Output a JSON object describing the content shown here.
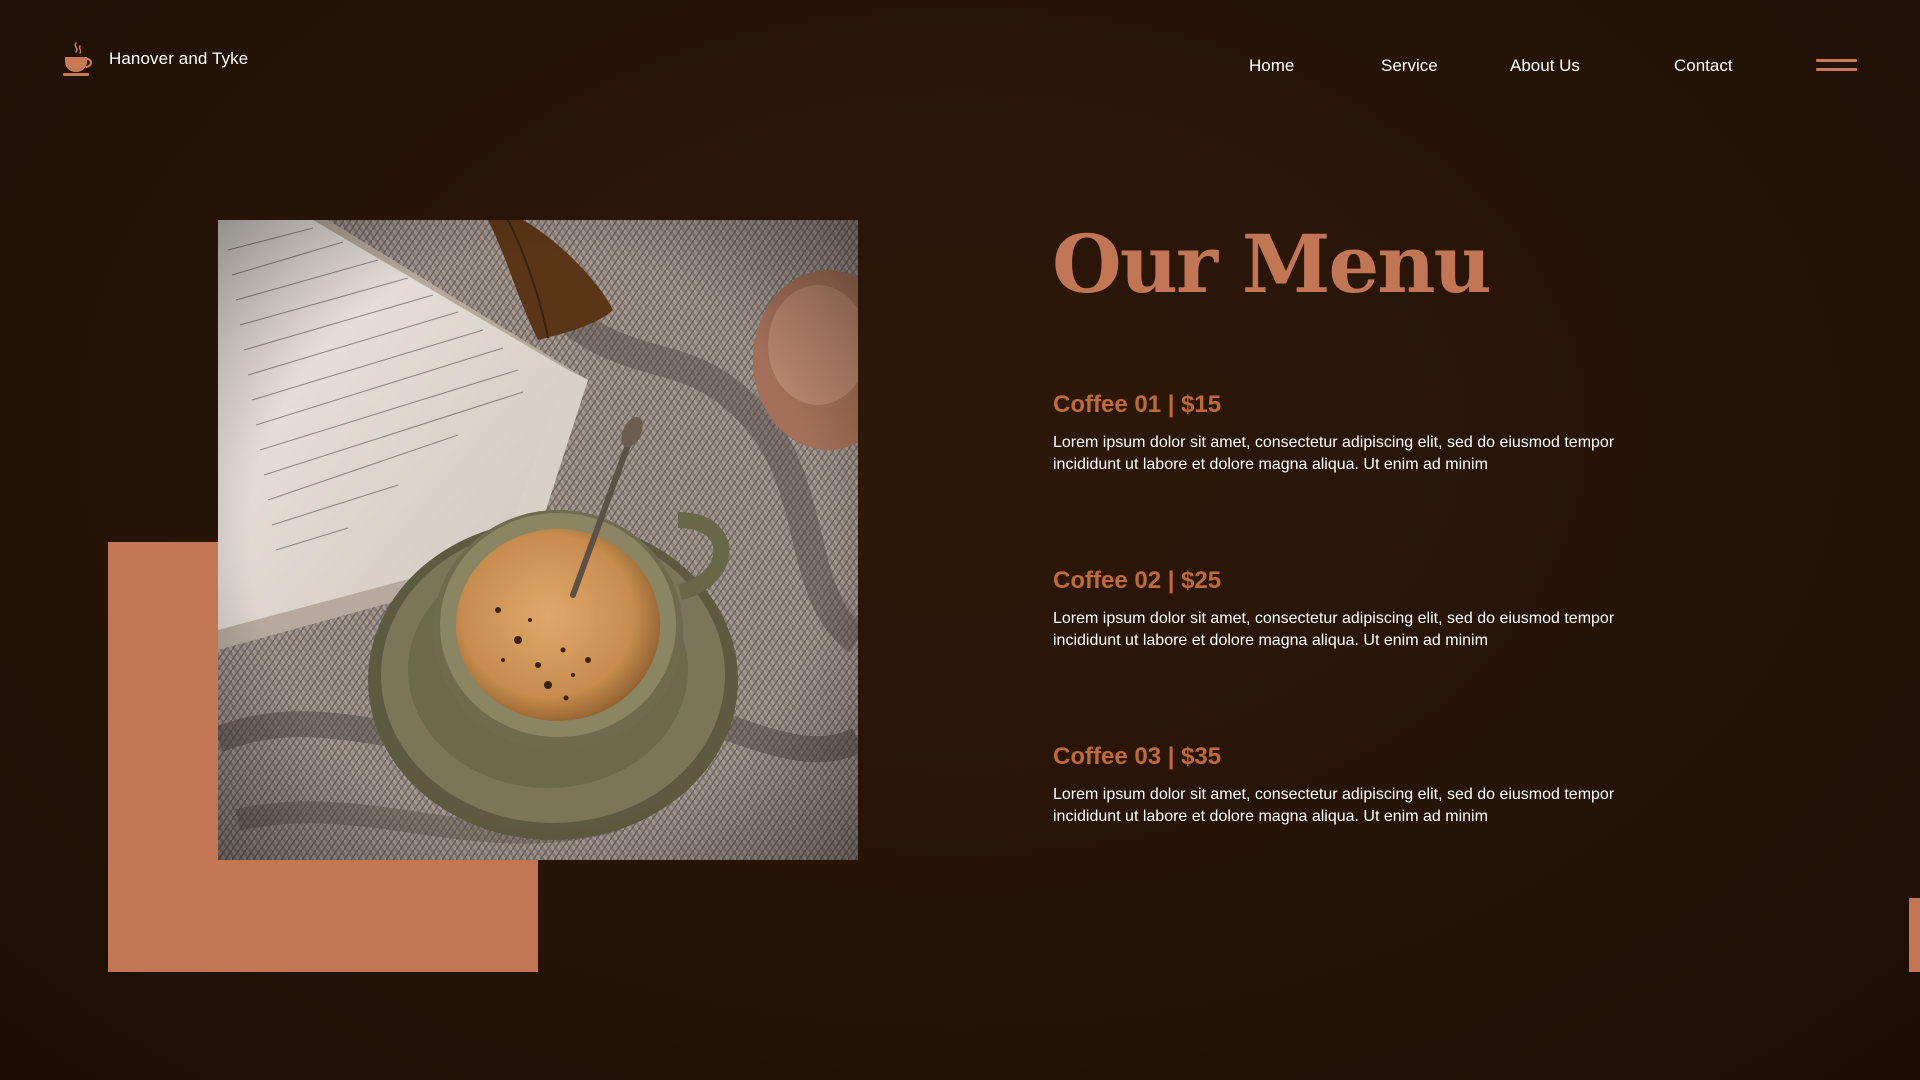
{
  "brand": {
    "name": "Hanover and Tyke",
    "icon": "coffee-cup-icon"
  },
  "nav": {
    "home": "Home",
    "service": "Service",
    "about": "About Us",
    "contact": "Contact",
    "menu_icon": "hamburger-menu-icon"
  },
  "hero": {
    "image_subject": "cup of coffee on a knitted blanket beside an open book",
    "title": "Our Menu"
  },
  "menu": {
    "items": [
      {
        "name": "Coffee 01 | $15",
        "description": "Lorem ipsum dolor sit amet, consectetur adipiscing elit, sed do eiusmod tempor incididunt ut labore et dolore magna aliqua. Ut enim ad minim"
      },
      {
        "name": "Coffee 02 | $25",
        "description": "Lorem ipsum dolor sit amet, consectetur adipiscing elit, sed do eiusmod tempor incididunt ut labore et dolore magna aliqua. Ut enim ad minim"
      },
      {
        "name": "Coffee 03 | $35",
        "description": "Lorem ipsum dolor sit amet, consectetur adipiscing elit, sed do eiusmod tempor incididunt ut labore et dolore magna aliqua. Ut enim ad minim"
      }
    ]
  },
  "colors": {
    "background": "#261407",
    "accent": "#c27653",
    "heading": "#c16a36",
    "text": "#ffffff"
  }
}
